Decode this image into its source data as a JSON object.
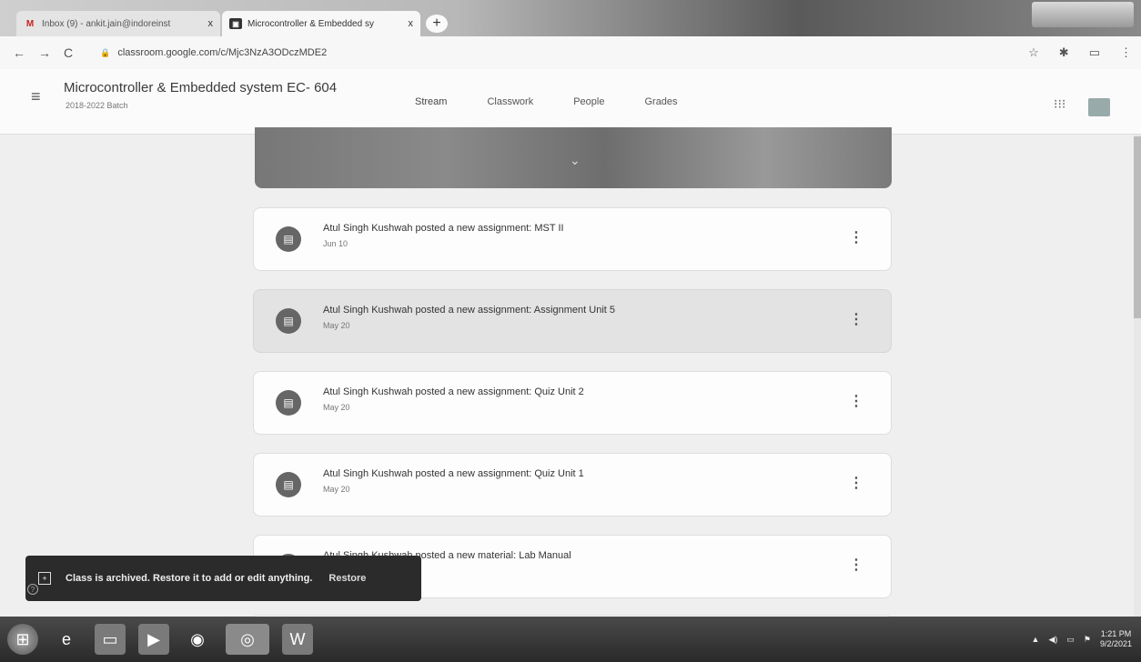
{
  "browser": {
    "tabs": [
      {
        "title": "Inbox (9) - ankit.jain@indoreinst",
        "icon": "gmail-icon",
        "active": false
      },
      {
        "title": "Microcontroller & Embedded sy",
        "icon": "classroom-icon",
        "active": true
      }
    ],
    "url": "classroom.google.com/c/Mjc3NzA3ODczMDE2",
    "new_tab_label": "+",
    "close_label": "x"
  },
  "header": {
    "class_title": "Microcontroller & Embedded system EC- 604",
    "class_subtitle": "2018-2022 Batch",
    "tabs": [
      "Stream",
      "Classwork",
      "People",
      "Grades"
    ],
    "active_tab": "Stream"
  },
  "stream": {
    "items": [
      {
        "text": "Atul Singh Kushwah posted a new assignment: MST II",
        "date": "Jun 10"
      },
      {
        "text": "Atul Singh Kushwah posted a new assignment: Assignment Unit 5",
        "date": "May 20"
      },
      {
        "text": "Atul Singh Kushwah posted a new assignment: Quiz Unit 2",
        "date": "May 20"
      },
      {
        "text": "Atul Singh Kushwah posted a new assignment: Quiz Unit 1",
        "date": "May 20"
      },
      {
        "text": "Atul Singh Kushwah posted a new material: Lab Manual",
        "date": ""
      }
    ]
  },
  "snackbar": {
    "message": "Class is archived. Restore it to add or edit anything.",
    "action": "Restore"
  },
  "taskbar": {
    "time": "1:21 PM",
    "date": "9/2/2021"
  },
  "colors": {
    "snackbar_bg": "#2b2b2b",
    "highlight_card": "#e3e3e3"
  }
}
